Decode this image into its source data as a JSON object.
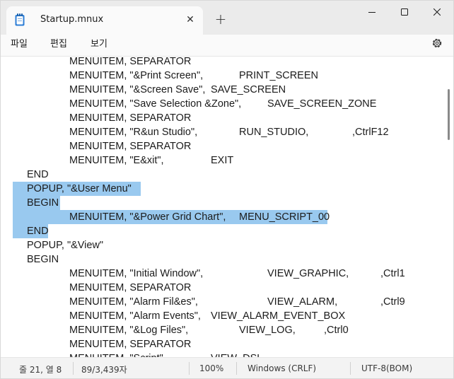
{
  "tab": {
    "title": "Startup.mnux",
    "close": "✕"
  },
  "titlebar": {
    "new_tab": "+"
  },
  "menu": {
    "file": "파일",
    "edit": "편집",
    "view": "보기"
  },
  "editor": {
    "lines": [
      "MENUITEM, SEPARATOR",
      "MENUITEM, \"&Print Screen\",",
      "PRINT_SCREEN",
      "MENUITEM, \"&Screen Save\",",
      "SAVE_SCREEN",
      "MENUITEM, \"Save Selection &Zone\",",
      "SAVE_SCREEN_ZONE",
      "MENUITEM, SEPARATOR",
      "MENUITEM, \"R&un Studio\",",
      "RUN_STUDIO,",
      ",CtrlF12",
      "MENUITEM, SEPARATOR",
      "MENUITEM, \"E&xit\",",
      "EXIT",
      "END",
      "POPUP, \"&User Menu\"",
      "BEGIN",
      "MENUITEM, \"&Power Grid Chart\",",
      "MENU_SCRIPT_00",
      "END",
      "POPUP, \"&View\"",
      "BEGIN",
      "MENUITEM, \"Initial Window\",",
      "VIEW_GRAPHIC,",
      ",Ctrl1",
      "MENUITEM, SEPARATOR",
      "MENUITEM, \"Alarm Fil&es\",",
      "VIEW_ALARM,",
      ",Ctrl9",
      "MENUITEM, \"Alarm Events\",",
      "VIEW_ALARM_EVENT_BOX",
      "MENUITEM, \"&Log Files\",",
      "VIEW_LOG,",
      ",Ctrl0",
      "MENUITEM, SEPARATOR",
      "MENUITEM, \"Script\",",
      "VIEW_DSL"
    ]
  },
  "status": {
    "position": "줄 21, 열 8",
    "chars": "89/3,439자",
    "zoom": "100%",
    "line_ending": "Windows (CRLF)",
    "encoding": "UTF-8(BOM)"
  }
}
